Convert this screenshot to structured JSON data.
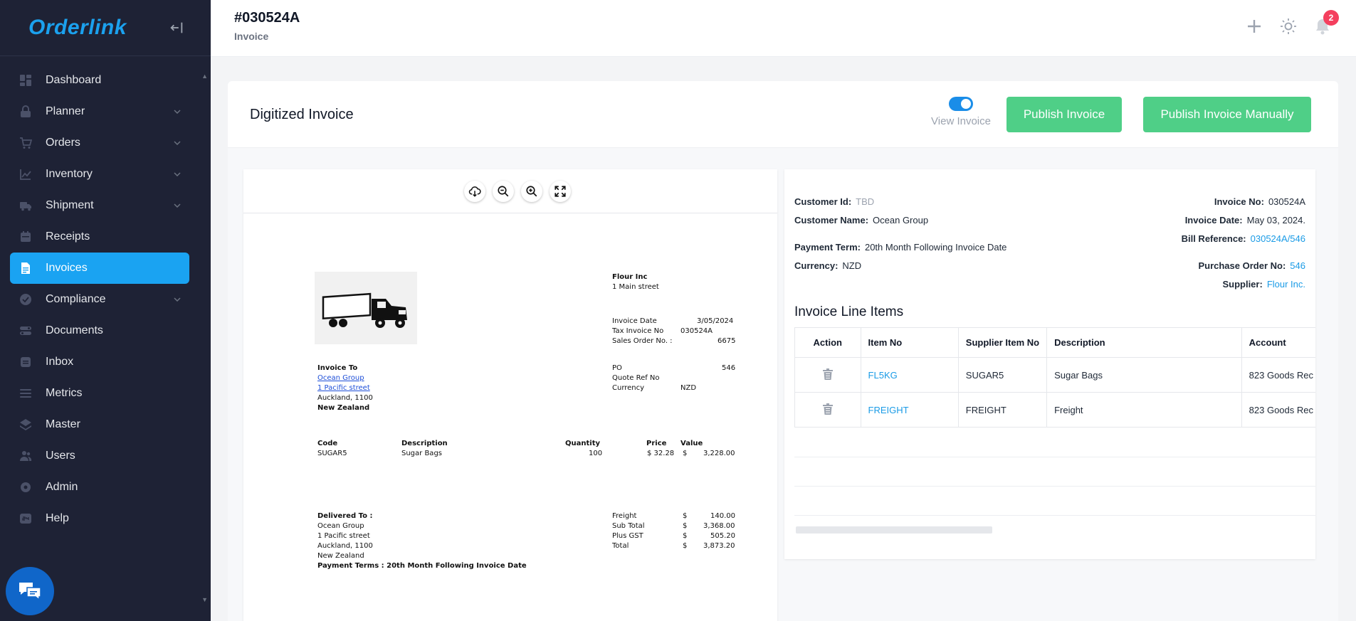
{
  "app": {
    "logo": "Orderlink"
  },
  "sidebar": {
    "items": [
      {
        "label": "Dashboard",
        "icon": "dashboard-icon",
        "expandable": false,
        "active": false
      },
      {
        "label": "Planner",
        "icon": "planner-icon",
        "expandable": true,
        "active": false
      },
      {
        "label": "Orders",
        "icon": "cart-icon",
        "expandable": true,
        "active": false
      },
      {
        "label": "Inventory",
        "icon": "chart-icon",
        "expandable": true,
        "active": false
      },
      {
        "label": "Shipment",
        "icon": "truck-icon",
        "expandable": true,
        "active": false
      },
      {
        "label": "Receipts",
        "icon": "receipt-icon",
        "expandable": false,
        "active": false
      },
      {
        "label": "Invoices",
        "icon": "invoice-icon",
        "expandable": false,
        "active": true
      },
      {
        "label": "Compliance",
        "icon": "check-circle-icon",
        "expandable": true,
        "active": false
      },
      {
        "label": "Documents",
        "icon": "documents-icon",
        "expandable": false,
        "active": false
      },
      {
        "label": "Inbox",
        "icon": "inbox-icon",
        "expandable": false,
        "active": false
      },
      {
        "label": "Metrics",
        "icon": "metrics-icon",
        "expandable": false,
        "active": false
      },
      {
        "label": "Master",
        "icon": "layers-icon",
        "expandable": false,
        "active": false
      },
      {
        "label": "Users",
        "icon": "users-icon",
        "expandable": false,
        "active": false
      },
      {
        "label": "Admin",
        "icon": "admin-icon",
        "expandable": false,
        "active": false
      },
      {
        "label": "Help",
        "icon": "help-24-icon",
        "expandable": false,
        "active": false
      }
    ]
  },
  "header": {
    "title": "#030524A",
    "subtitle": "Invoice",
    "notification_count": "2"
  },
  "card": {
    "title": "Digitized Invoice",
    "toggle_label": "View Invoice",
    "toggle_on": true,
    "publish_label": "Publish Invoice",
    "publish_manual_label": "Publish Invoice Manually"
  },
  "document": {
    "seller_name": "Flour Inc",
    "seller_address": "1 Main street",
    "invoice_date_label": "Invoice Date",
    "invoice_date_value": "3/05/2024",
    "tax_invoice_label": "Tax Invoice No",
    "tax_invoice_value": "030524A",
    "sales_order_label": "Sales Order No. :",
    "sales_order_value": "6675",
    "invoice_to_label": "Invoice To",
    "invoice_to_name": "Ocean Group",
    "invoice_to_street": "1 Pacific street",
    "invoice_to_city": "Auckland, 1100",
    "invoice_to_country": "New Zealand",
    "po_label": "PO",
    "po_value": "546",
    "quote_ref_label": "Quote Ref No",
    "currency_label": "Currency",
    "currency_value": "NZD",
    "col_code": "Code",
    "col_description": "Description",
    "col_quantity": "Quantity",
    "col_price": "Price",
    "col_value": "Value",
    "line_code": "SUGAR5",
    "line_description": "Sugar Bags",
    "line_quantity": "100",
    "line_price": "$  32.28",
    "line_value_symbol": "$",
    "line_value": "3,228.00",
    "delivered_to_label": "Delivered To :",
    "delivered_name": "Ocean Group",
    "delivered_street": "1 Pacific street",
    "delivered_city": "Auckland, 1100",
    "delivered_country": "New Zealand",
    "payment_terms": "Payment Terms : 20th Month Following Invoice Date",
    "totals": [
      {
        "label": "Freight",
        "symbol": "$",
        "value": "140.00"
      },
      {
        "label": "Sub Total",
        "symbol": "$",
        "value": "3,368.00"
      },
      {
        "label": "Plus GST",
        "symbol": "$",
        "value": "505.20"
      },
      {
        "label": "Total",
        "symbol": "$",
        "value": "3,873.20"
      }
    ]
  },
  "details": {
    "customer_id_label": "Customer Id:",
    "customer_id_value": "TBD",
    "customer_name_label": "Customer Name:",
    "customer_name_value": "Ocean Group",
    "payment_term_label": "Payment Term:",
    "payment_term_value": "20th Month Following Invoice Date",
    "currency_label": "Currency:",
    "currency_value": "NZD",
    "invoice_no_label": "Invoice No:",
    "invoice_no_value": "030524A",
    "invoice_date_label": "Invoice Date:",
    "invoice_date_value": "May 03, 2024.",
    "bill_reference_label": "Bill Reference:",
    "bill_reference_value": "030524A/546",
    "purchase_order_label": "Purchase Order No:",
    "purchase_order_value": "546",
    "supplier_label": "Supplier:",
    "supplier_value": "Flour Inc."
  },
  "line_items": {
    "title": "Invoice Line Items",
    "columns": [
      "Action",
      "Item No",
      "Supplier Item No",
      "Description",
      "Account"
    ],
    "rows": [
      {
        "item_no": "FL5KG",
        "supplier_item_no": "SUGAR5",
        "description": "Sugar Bags",
        "account": "823 Goods Rec"
      },
      {
        "item_no": "FREIGHT",
        "supplier_item_no": "FREIGHT",
        "description": "Freight",
        "account": "823 Goods Rec"
      }
    ]
  },
  "colors": {
    "sidebar_bg": "#1e2235",
    "accent": "#1aa3f2",
    "button_green": "#4fcf87",
    "badge_red": "#f43f5e",
    "link_blue": "#1a9be6"
  }
}
